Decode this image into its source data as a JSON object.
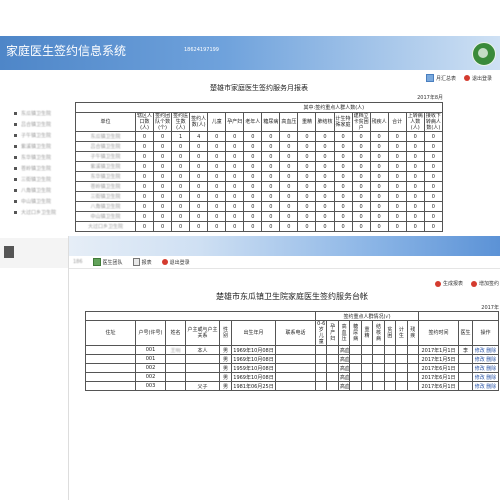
{
  "window1": {
    "title": "家庭医生签约信息系统",
    "phone": "18624197199",
    "toolbar": [
      {
        "icon": "report-icon",
        "label": "月汇总表"
      },
      {
        "icon": "logout-icon",
        "label": "退出登录"
      }
    ],
    "sidebar": [
      "东瓜镇卫生院",
      "吕合镇卫生院",
      "子午镇卫生院",
      "紫溪镇卫生院",
      "东华镇卫生院",
      "苍岭镇卫生院",
      "三街镇卫生院",
      "八角镇卫生院",
      "中山镇卫生院",
      "大过口乡卫生院"
    ],
    "report": {
      "title": "楚雄市家庭医生签约服务月报表",
      "date": "2017年8月",
      "headers": [
        "单位",
        "辖区人口数(人)",
        "签约团队个数(个)",
        "签约医生数(人)",
        "签约人数(人)",
        "儿童",
        "孕产妇",
        "老年人",
        "糖尿病",
        "高血压",
        "重精",
        "肺结核",
        "计生特殊家庭",
        "建档立卡贫困户",
        "残疾人",
        "合计",
        "上转病人数(人)",
        "接收下转病人数(人)"
      ],
      "group_header": "其中:签约重点人群人数(人)",
      "rows": [
        [
          "东瓜镇卫生院",
          "0",
          "0",
          "1",
          "4",
          "0",
          "0",
          "0",
          "0",
          "0",
          "0",
          "0",
          "0",
          "0",
          "0",
          "0",
          "0",
          "0"
        ],
        [
          "吕合镇卫生院",
          "0",
          "0",
          "0",
          "0",
          "0",
          "0",
          "0",
          "0",
          "0",
          "0",
          "0",
          "0",
          "0",
          "0",
          "0",
          "0",
          "0"
        ],
        [
          "子午镇卫生院",
          "0",
          "0",
          "0",
          "0",
          "0",
          "0",
          "0",
          "0",
          "0",
          "0",
          "0",
          "0",
          "0",
          "0",
          "0",
          "0",
          "0"
        ],
        [
          "紫溪镇卫生院",
          "0",
          "0",
          "0",
          "0",
          "0",
          "0",
          "0",
          "0",
          "0",
          "0",
          "0",
          "0",
          "0",
          "0",
          "0",
          "0",
          "0"
        ],
        [
          "东华镇卫生院",
          "0",
          "0",
          "0",
          "0",
          "0",
          "0",
          "0",
          "0",
          "0",
          "0",
          "0",
          "0",
          "0",
          "0",
          "0",
          "0",
          "0"
        ],
        [
          "苍岭镇卫生院",
          "0",
          "0",
          "0",
          "0",
          "0",
          "0",
          "0",
          "0",
          "0",
          "0",
          "0",
          "0",
          "0",
          "0",
          "0",
          "0",
          "0"
        ],
        [
          "三街镇卫生院",
          "0",
          "0",
          "0",
          "0",
          "0",
          "0",
          "0",
          "0",
          "0",
          "0",
          "0",
          "0",
          "0",
          "0",
          "0",
          "0",
          "0"
        ],
        [
          "八角镇卫生院",
          "0",
          "0",
          "0",
          "0",
          "0",
          "0",
          "0",
          "0",
          "0",
          "0",
          "0",
          "0",
          "0",
          "0",
          "0",
          "0",
          "0"
        ],
        [
          "中山镇卫生院",
          "0",
          "0",
          "0",
          "0",
          "0",
          "0",
          "0",
          "0",
          "0",
          "0",
          "0",
          "0",
          "0",
          "0",
          "0",
          "0",
          "0"
        ],
        [
          "大过口乡卫生院",
          "0",
          "0",
          "0",
          "0",
          "0",
          "0",
          "0",
          "0",
          "0",
          "0",
          "0",
          "0",
          "0",
          "0",
          "0",
          "0",
          "0"
        ]
      ]
    }
  },
  "window2": {
    "phone": "186",
    "toolbar": [
      {
        "icon": "team-icon",
        "label": "医生团队"
      },
      {
        "icon": "report-icon",
        "label": "报表"
      },
      {
        "icon": "logout-icon",
        "label": "退出登录"
      }
    ],
    "actions": [
      {
        "icon": "export-icon",
        "label": "生成报表"
      },
      {
        "icon": "add-icon",
        "label": "增加签约"
      }
    ],
    "report": {
      "title": "楚雄市东瓜镇卫生院家庭医生签约服务台帐",
      "date": "2017年",
      "headers": [
        "住址",
        "户号(许号)",
        "姓名",
        "户主或与户主关系",
        "性别",
        "出生年月",
        "联系电话",
        "0-6岁儿童",
        "孕产妇",
        "高血压",
        "糖尿病",
        "重精",
        "结核病",
        "贫困",
        "计生",
        "残疾",
        "签约时间",
        "医生",
        "操作"
      ],
      "group_header": "签约重点人群情况(√)",
      "rows": [
        [
          "",
          "001",
          "王明",
          "本人",
          "男",
          "1969年10月08日",
          "",
          "",
          "",
          "高血压",
          "",
          "",
          "",
          "",
          "",
          "",
          "2017年1月1日",
          "李",
          "修改 删除"
        ],
        [
          "",
          "001",
          "",
          "",
          "男",
          "1969年10月08日",
          "",
          "",
          "",
          "高血压",
          "",
          "",
          "",
          "",
          "",
          "",
          "2017年1月5日",
          "",
          "修改 删除"
        ],
        [
          "",
          "002",
          "",
          "",
          "男",
          "1959年10月08日",
          "",
          "",
          "",
          "高血压",
          "",
          "",
          "",
          "",
          "",
          "",
          "2017年6月1日",
          "",
          "修改 删除"
        ],
        [
          "",
          "002",
          "",
          "",
          "男",
          "1969年10月08日",
          "",
          "",
          "",
          "高血压",
          "",
          "",
          "",
          "",
          "",
          "",
          "2017年6月1日",
          "",
          "修改 删除"
        ],
        [
          "",
          "003",
          "",
          "父子",
          "男",
          "1981年06月25日",
          "",
          "",
          "",
          "高血压",
          "",
          "",
          "",
          "",
          "",
          "",
          "2017年6月1日",
          "",
          "修改 删除"
        ]
      ]
    }
  }
}
